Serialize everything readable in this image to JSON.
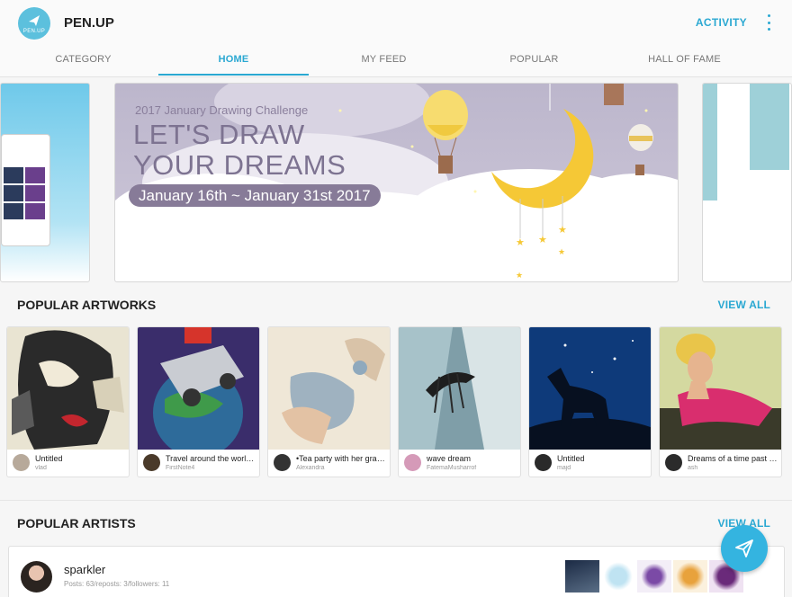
{
  "header": {
    "logo_text": "PEN.UP",
    "app_title": "PEN.UP",
    "activity_label": "ACTIVITY",
    "more_icon": "more-vertical-icon"
  },
  "tabs": [
    {
      "label": "CATEGORY",
      "active": false
    },
    {
      "label": "HOME",
      "active": true
    },
    {
      "label": "MY FEED",
      "active": false
    },
    {
      "label": "POPULAR",
      "active": false
    },
    {
      "label": "HALL OF FAME",
      "active": false
    }
  ],
  "banner": {
    "subtitle": "2017 January Drawing Challenge",
    "title": "LET'S DRAW YOUR DREAMS",
    "dates": "January 16th ~ January 31st 2017"
  },
  "popular_artworks": {
    "title": "POPULAR ARTWORKS",
    "view_all": "VIEW ALL",
    "items": [
      {
        "title": "Untitled",
        "author": "vlad"
      },
      {
        "title": "Travel around the world ...",
        "author": "FirstNote4"
      },
      {
        "title": "•Tea party with her gran...",
        "author": "Alexandra"
      },
      {
        "title": "wave dream",
        "author": "FatemaMusharrof"
      },
      {
        "title": "Untitled",
        "author": "majd"
      },
      {
        "title": "Dreams of a time past (...",
        "author": "ash"
      }
    ]
  },
  "popular_artists": {
    "title": "POPULAR ARTISTS",
    "view_all": "VIEW ALL",
    "artists": [
      {
        "name": "sparkler",
        "stats": "Posts: 63/reposts: 3/followers: 11"
      }
    ]
  },
  "fab": {
    "icon": "send-icon"
  },
  "colors": {
    "accent": "#2aa8d2",
    "fab": "#34b4e0"
  }
}
